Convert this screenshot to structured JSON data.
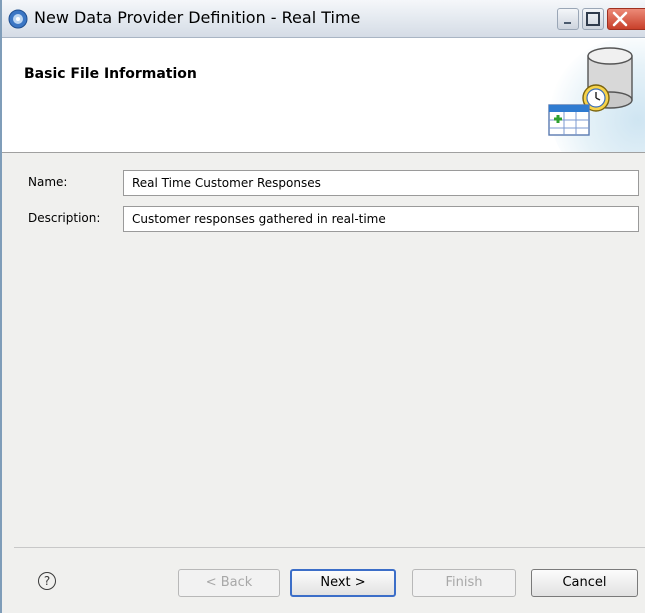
{
  "window": {
    "title": "New Data Provider Definition - Real Time"
  },
  "banner": {
    "title": "Basic File Information",
    "graphic": "database-clock-icon"
  },
  "form": {
    "name_label": "Name:",
    "name_value": "Real Time Customer Responses",
    "description_label": "Description:",
    "description_value": "Customer responses gathered in real-time"
  },
  "footer": {
    "help_icon": "help-icon",
    "help_glyph": "?",
    "back": {
      "label": "< Back",
      "enabled": false
    },
    "next": {
      "label": "Next >",
      "enabled": true,
      "default": true
    },
    "finish": {
      "label": "Finish",
      "enabled": false
    },
    "cancel": {
      "label": "Cancel",
      "enabled": true
    }
  },
  "colors": {
    "default_button_border": "#3c6ec8",
    "close_button": "#c8402a"
  }
}
